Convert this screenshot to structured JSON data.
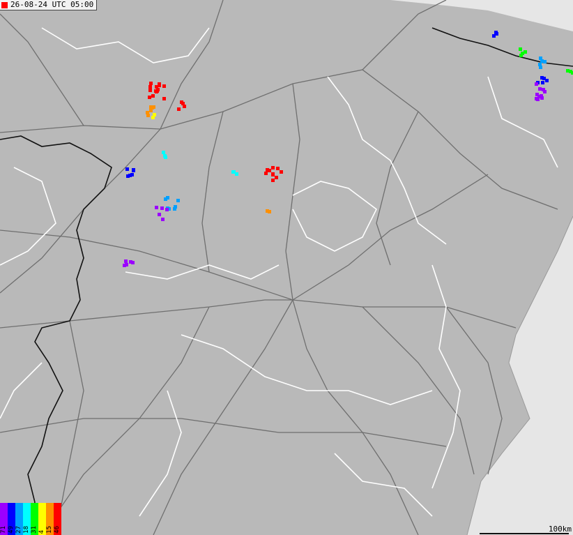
{
  "header": {
    "timestamp": "26-08-24 UTC 05:00",
    "marker_color": "#ff0000"
  },
  "legend": [
    {
      "label": "71",
      "color": "#9b00ff"
    },
    {
      "label": "49",
      "color": "#0000ff"
    },
    {
      "label": "27",
      "color": "#00a0ff"
    },
    {
      "label": "18",
      "color": "#00ffff"
    },
    {
      "label": "31",
      "color": "#00ff00"
    },
    {
      "label": "4",
      "color": "#ffff00"
    },
    {
      "label": "15",
      "color": "#ff9000"
    },
    {
      "label": "46",
      "color": "#ff0000"
    }
  ],
  "scale": {
    "label": "100km"
  },
  "map_colors": {
    "land": "#b9b9b9",
    "sea": "#e6e6e6",
    "roads": "#6f6f6f",
    "borders": "#ffffff",
    "country_border": "#111111"
  }
}
